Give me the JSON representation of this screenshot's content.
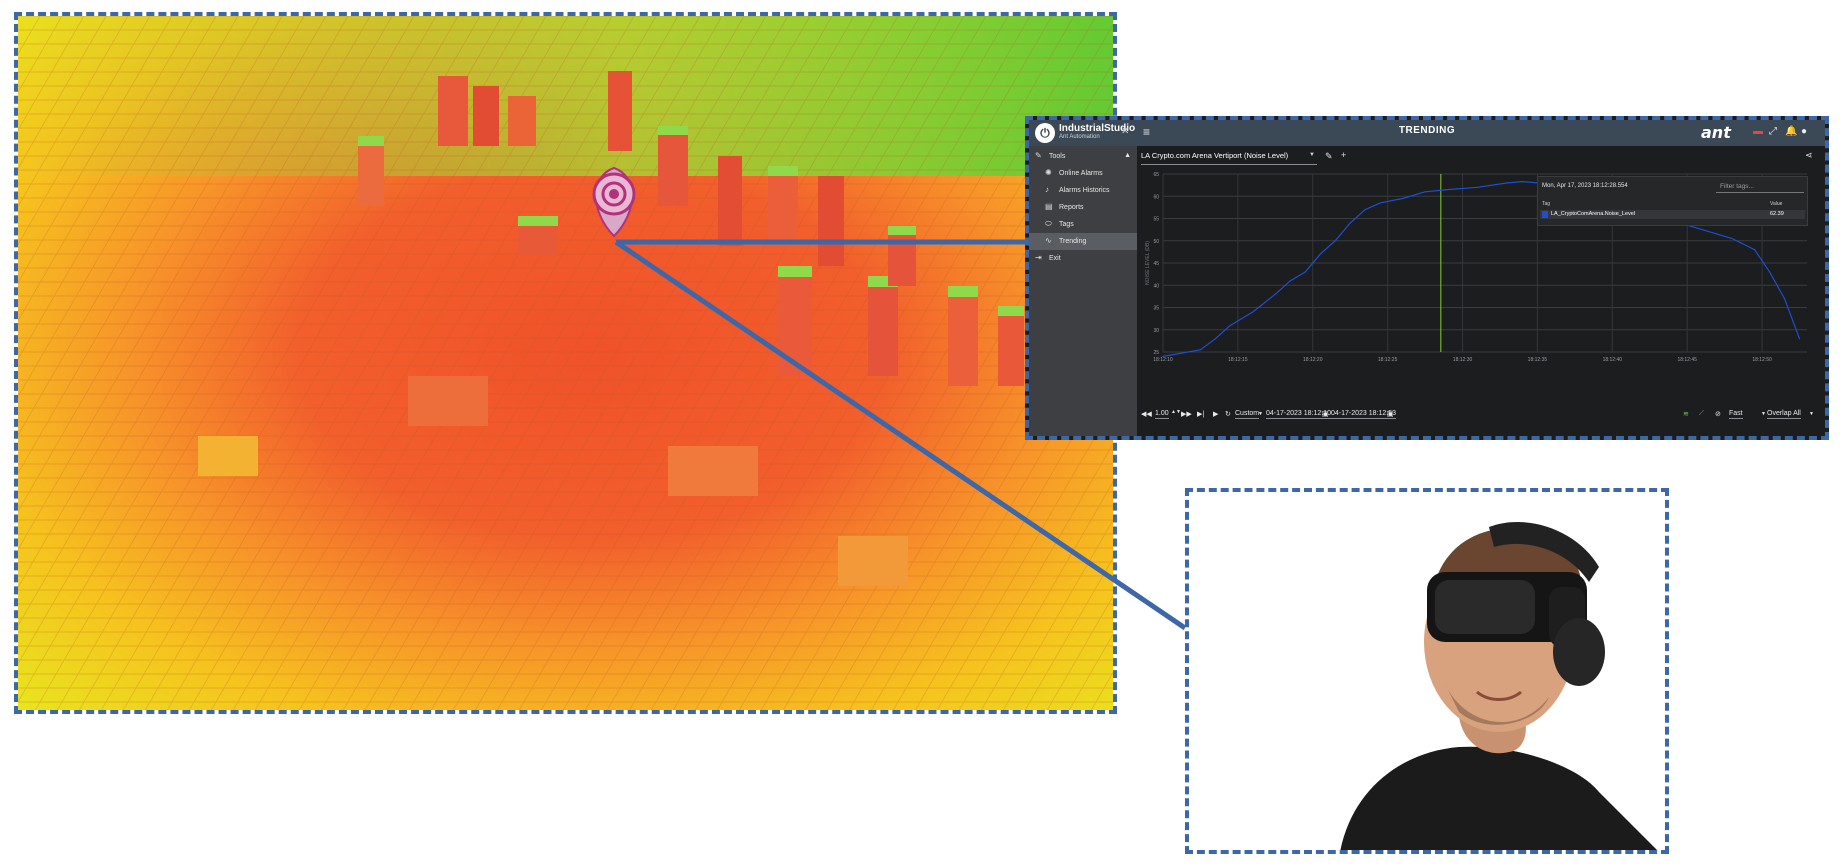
{
  "app": {
    "brand_name": "IndustrialStudio",
    "brand_sub": "Ant Automation",
    "page_title": "TRENDING",
    "ant_logo": "ant",
    "topbar_icons": [
      "menu-icon",
      "pin-icon",
      "flag-icon",
      "fullscreen-icon",
      "bell-icon",
      "user-icon"
    ]
  },
  "sidebar": {
    "items": [
      {
        "label": "Tools",
        "icon": "wrench-icon"
      },
      {
        "label": "Online Alarms",
        "icon": "alarm-icon"
      },
      {
        "label": "Alarms Historics",
        "icon": "bell-icon"
      },
      {
        "label": "Reports",
        "icon": "clipboard-icon"
      },
      {
        "label": "Tags",
        "icon": "tag-icon"
      },
      {
        "label": "Trending",
        "icon": "trend-icon"
      },
      {
        "label": "Exit",
        "icon": "exit-icon"
      }
    ],
    "active": "Trending"
  },
  "trend": {
    "selected": "LA Crypto.com Arena Vertiport (Noise Level)",
    "legend": {
      "date": "Mon, Apr 17, 2023 18:12:28.554",
      "filter_placeholder": "Filter tags...",
      "col_tag": "Tag",
      "col_value": "Value",
      "tag": "LA_CryptoComArena.Noise_Level",
      "value": "62.39"
    }
  },
  "controls": {
    "speed": "1.00",
    "range_mode": "Custom",
    "start": "04-17-2023 18:12:10",
    "end": "04-17-2023 18:12:53",
    "rate": "Fast",
    "overlap": "Overlap All"
  },
  "chart_data": {
    "type": "line",
    "ylabel": "NOISE LEVEL (DB)",
    "ylim": [
      25,
      65
    ],
    "yticks": [
      "25",
      "30",
      "35",
      "40",
      "45",
      "50",
      "55",
      "60",
      "65"
    ],
    "xticks": [
      "18:12:10",
      "18:12:15",
      "18:12:20",
      "18:12:25",
      "18:12:30",
      "18:12:35",
      "18:12:40",
      "18:12:45",
      "18:12:50"
    ],
    "x": [
      10,
      12.5,
      13.5,
      14.5,
      16,
      17.5,
      18.5,
      19.5,
      20.5,
      21.5,
      22.5,
      23.5,
      24.5,
      26,
      27.5,
      29,
      31,
      33,
      34,
      35,
      37,
      38,
      39,
      41,
      42,
      43,
      44,
      45.5,
      47,
      48,
      49.5,
      50.5,
      51.5,
      52.5
    ],
    "y": [
      24,
      25.5,
      28,
      31,
      34,
      38,
      41,
      43,
      47,
      50,
      54,
      57,
      58.5,
      59.5,
      61,
      61.5,
      62,
      63,
      63.3,
      63,
      62.5,
      61,
      59.5,
      58.5,
      57.5,
      56,
      54.5,
      53,
      51.5,
      50.5,
      48,
      43,
      37,
      28
    ],
    "cursor_x": 28.55,
    "series": [
      {
        "name": "LA_CryptoComArena.Noise_Level",
        "color": "#1f4fd1"
      }
    ],
    "grid": true,
    "legend": "top-right"
  }
}
